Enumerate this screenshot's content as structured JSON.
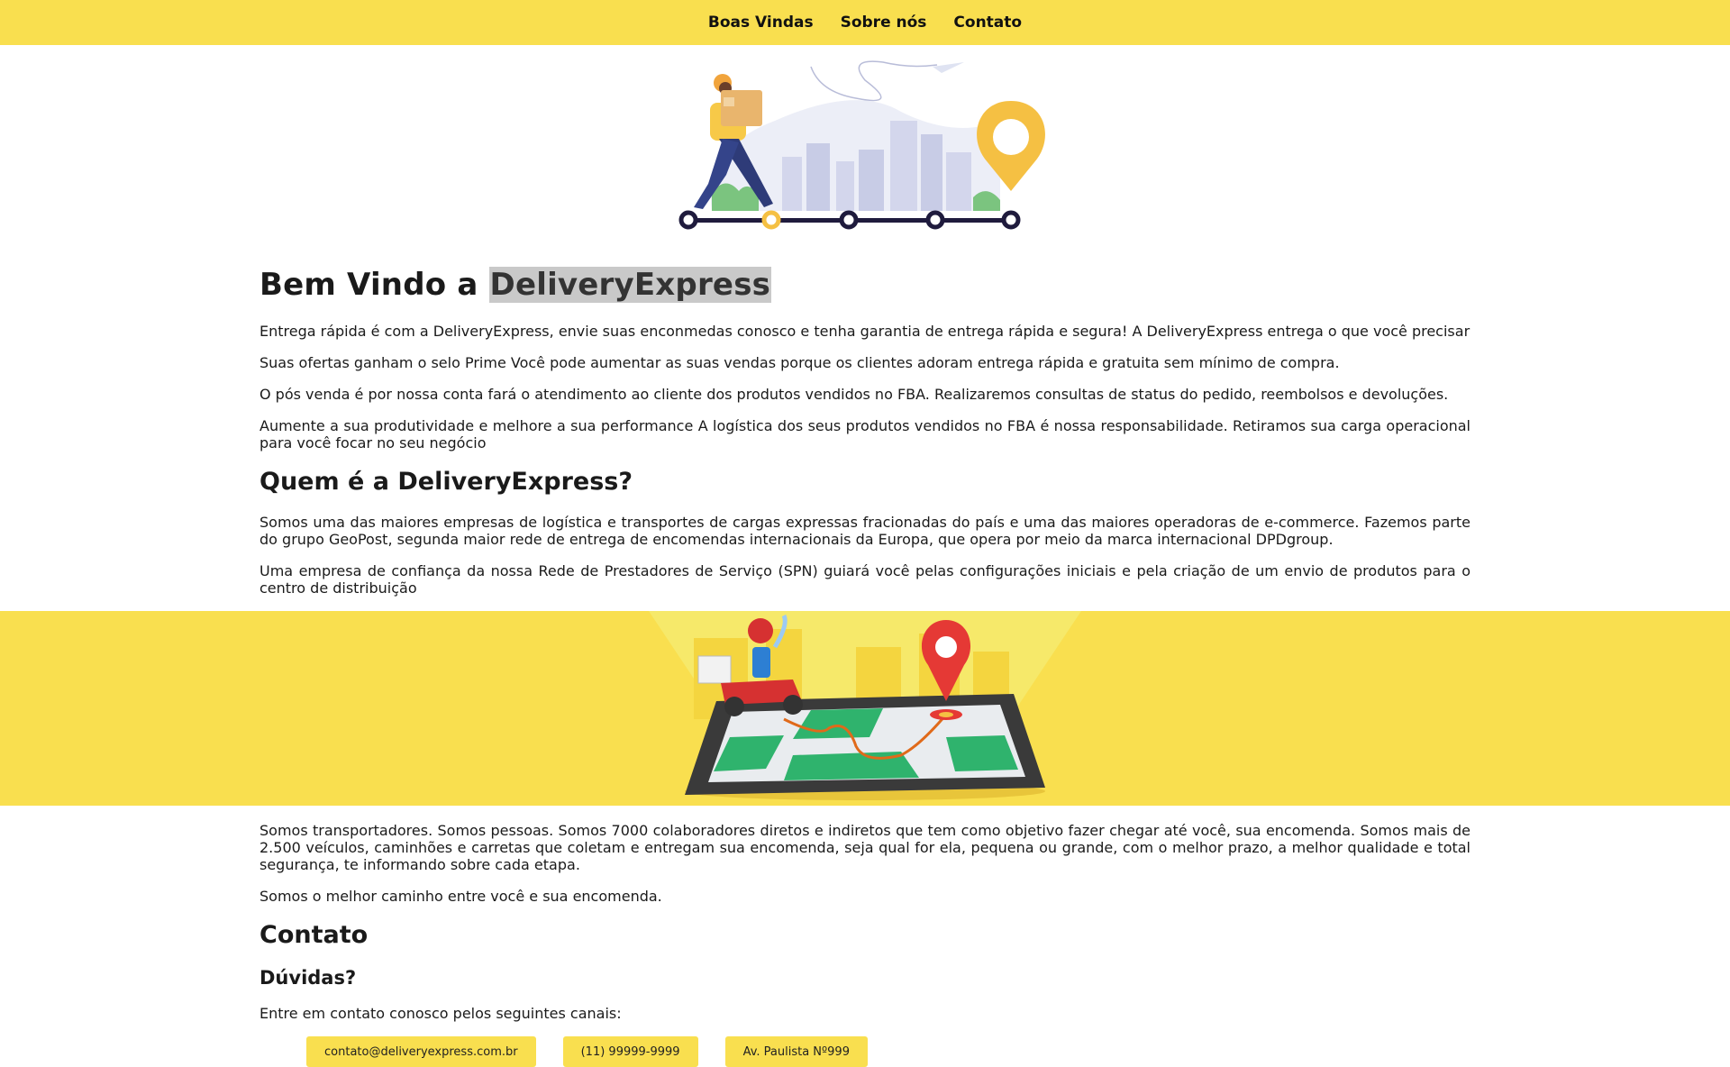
{
  "nav": {
    "items": [
      "Boas Vindas",
      "Sobre nós",
      "Contato"
    ]
  },
  "welcome": {
    "title_prefix": "Bem Vindo a ",
    "title_brand": "DeliveryExpress",
    "paragraphs": [
      "Entrega rápida é com a DeliveryExpress, envie suas enconmedas conosco e tenha garantia de entrega rápida e segura! A DeliveryExpress entrega o que você precisar",
      "Suas ofertas ganham o selo Prime Você pode aumentar as suas vendas porque os clientes adoram entrega rápida e gratuita sem mínimo de compra.",
      "O pós venda é por nossa conta fará o atendimento ao cliente dos produtos vendidos no FBA. Realizaremos consultas de status do pedido, reembolsos e devoluções.",
      "Aumente a sua produtividade e melhore a sua performance A logística dos seus produtos vendidos no FBA é nossa responsabilidade. Retiramos sua carga operacional para você focar no seu negócio"
    ]
  },
  "about": {
    "title": "Quem é a DeliveryExpress?",
    "paragraphs": [
      "Somos uma das maiores empresas de logística e transportes de cargas expressas fracionadas do país e uma das maiores operadoras de e-commerce. Fazemos parte do grupo GeoPost, segunda maior rede de entrega de encomendas internacionais da Europa, que opera por meio da marca internacional DPDgroup.",
      "Uma empresa de confiança da nossa Rede de Prestadores de Serviço (SPN) guiará você pelas configurações iniciais e pela criação de um envio de produtos para o centro de distribuição"
    ]
  },
  "transport": {
    "paragraphs": [
      "Somos transportadores. Somos pessoas. Somos 7000 colaboradores diretos e indiretos que tem como objetivo fazer chegar até você, sua encomenda. Somos mais de 2.500 veículos, caminhões e carretas que coletam e entregam sua encomenda, seja qual for ela, pequena ou grande, com o melhor prazo, a melhor qualidade e total segurança, te informando sobre cada etapa.",
      "Somos o melhor caminho entre você e sua encomenda."
    ]
  },
  "contact": {
    "title": "Contato",
    "subtitle": "Dúvidas?",
    "intro": "Entre em contato conosco pelos seguintes canais:",
    "channels": [
      "contato@deliveryexpress.com.br",
      "(11) 99999-9999",
      "Av. Paulista Nº999"
    ]
  },
  "colors": {
    "accent": "#f9df4f",
    "pin_yellow": "#f5c043",
    "pin_red": "#e53935",
    "map_green": "#2fb36d"
  },
  "icons": [
    "delivery-man-illustration",
    "scooter-map-illustration",
    "location-pin-icon",
    "paper-plane-icon"
  ]
}
